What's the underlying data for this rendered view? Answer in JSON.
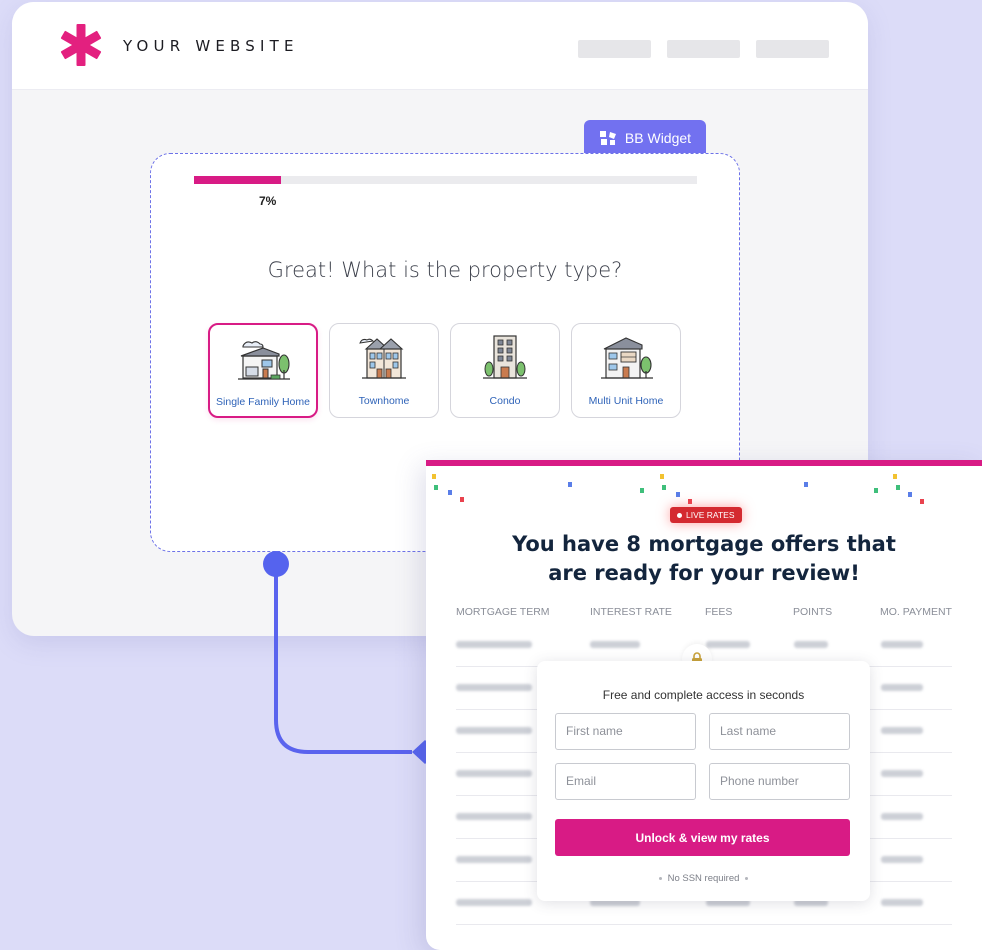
{
  "site": {
    "logo_text": "YOUR WEBSITE",
    "brand_color": "#d81b85",
    "nav_placeholders": 3
  },
  "widget": {
    "tag_label": "BB Widget",
    "progress_value": 7,
    "progress_label": "7%",
    "question": "Great! What is the property type?",
    "options": [
      {
        "label": "Single Family Home",
        "icon": "single-family-home-icon",
        "selected": true
      },
      {
        "label": "Townhome",
        "icon": "townhome-icon",
        "selected": false
      },
      {
        "label": "Condo",
        "icon": "condo-icon",
        "selected": false
      },
      {
        "label": "Multi Unit Home",
        "icon": "multi-unit-home-icon",
        "selected": false
      }
    ]
  },
  "offers": {
    "badge": "LIVE RATES",
    "title_line1": "You have 8 mortgage offers that",
    "title_line2": "are ready for your review!",
    "columns": [
      "MORTGAGE TERM",
      "INTEREST RATE",
      "FEES",
      "POINTS",
      "MO. PAYMENT"
    ],
    "blurred_rows": 7
  },
  "form": {
    "title": "Free and complete access in seconds",
    "first_name_placeholder": "First name",
    "last_name_placeholder": "Last name",
    "email_placeholder": "Email",
    "phone_placeholder": "Phone number",
    "submit_label": "Unlock & view my rates",
    "note": "No SSN required"
  },
  "colors": {
    "accent": "#d81b85",
    "widget_purple": "#7271f0",
    "connector_blue": "#5a63ee",
    "background": "#dcdcf8"
  }
}
